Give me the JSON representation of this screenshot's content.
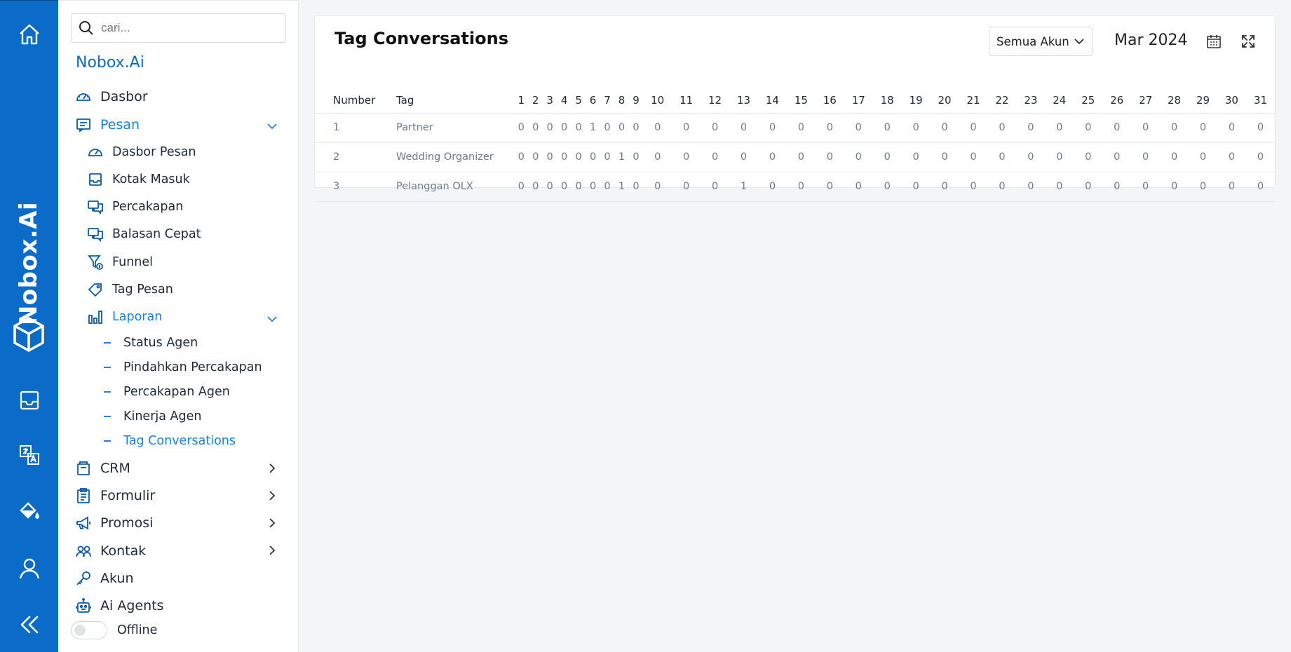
{
  "rail": {
    "brand": "Nobox.Ai",
    "items": [
      "home-icon",
      "inbox-icon",
      "translate-icon",
      "paint-bucket-icon",
      "user-icon",
      "collapse-icon"
    ]
  },
  "sidebar": {
    "search_placeholder": "cari...",
    "org_name": "Nobox.Ai",
    "menu": {
      "dasbor": "Dasbor",
      "pesan": "Pesan",
      "pesan_children": {
        "dasbor_pesan": "Dasbor Pesan",
        "kotak_masuk": "Kotak Masuk",
        "percakapan": "Percakapan",
        "balasan_cepat": "Balasan Cepat",
        "funnel": "Funnel",
        "tag_pesan": "Tag Pesan",
        "laporan": "Laporan"
      },
      "laporan_children": {
        "status_agen": "Status Agen",
        "pindahkan_percakapan": "Pindahkan Percakapan",
        "percakapan_agen": "Percakapan Agen",
        "kinerja_agen": "Kinerja Agen",
        "tag_conversations": "Tag Conversations"
      },
      "crm": "CRM",
      "formulir": "Formulir",
      "promosi": "Promosi",
      "kontak": "Kontak",
      "akun": "Akun",
      "ai_agents": "Ai Agents"
    },
    "status_label": "Offline"
  },
  "main": {
    "title": "Tag Conversations",
    "account_filter": "Semua Akun",
    "month": "Mar 2024",
    "table": {
      "col_number": "Number",
      "col_tag": "Tag",
      "days": [
        "1",
        "2",
        "3",
        "4",
        "5",
        "6",
        "7",
        "8",
        "9",
        "10",
        "11",
        "12",
        "13",
        "14",
        "15",
        "16",
        "17",
        "18",
        "19",
        "20",
        "21",
        "22",
        "23",
        "24",
        "25",
        "26",
        "27",
        "28",
        "29",
        "30",
        "31"
      ],
      "rows": [
        {
          "number": "1",
          "tag": "Partner",
          "values": [
            "0",
            "0",
            "0",
            "0",
            "0",
            "1",
            "0",
            "0",
            "0",
            "0",
            "0",
            "0",
            "0",
            "0",
            "0",
            "0",
            "0",
            "0",
            "0",
            "0",
            "0",
            "0",
            "0",
            "0",
            "0",
            "0",
            "0",
            "0",
            "0",
            "0",
            "0"
          ]
        },
        {
          "number": "2",
          "tag": "Wedding Organizer",
          "values": [
            "0",
            "0",
            "0",
            "0",
            "0",
            "0",
            "0",
            "1",
            "0",
            "0",
            "0",
            "0",
            "0",
            "0",
            "0",
            "0",
            "0",
            "0",
            "0",
            "0",
            "0",
            "0",
            "0",
            "0",
            "0",
            "0",
            "0",
            "0",
            "0",
            "0",
            "0"
          ]
        },
        {
          "number": "3",
          "tag": "Pelanggan OLX",
          "values": [
            "0",
            "0",
            "0",
            "0",
            "0",
            "0",
            "0",
            "1",
            "0",
            "0",
            "0",
            "0",
            "1",
            "0",
            "0",
            "0",
            "0",
            "0",
            "0",
            "0",
            "0",
            "0",
            "0",
            "0",
            "0",
            "0",
            "0",
            "0",
            "0",
            "0",
            "0"
          ]
        }
      ]
    }
  }
}
